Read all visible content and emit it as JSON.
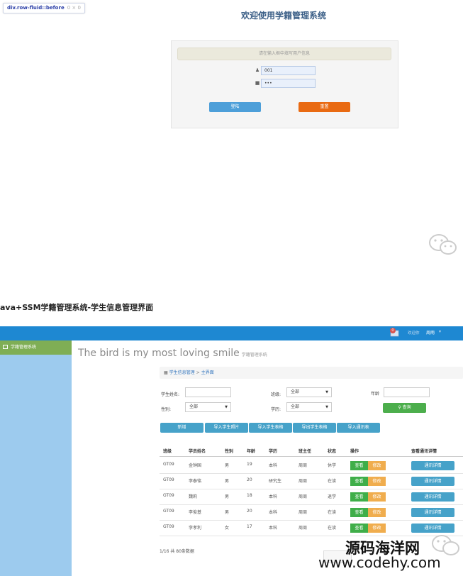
{
  "devtools_tag": {
    "selector": "div.row-fluid::before",
    "size": "0 × 0"
  },
  "login": {
    "title": "欢迎使用学籍管理系统",
    "hint": "请在输入框中填写用户信息",
    "username_value": "001",
    "password_value": "•••",
    "login_button": "登陆",
    "reset_button": "重置"
  },
  "caption": "ava+SSM学籍管理系统-学生信息管理界面",
  "topbar": {
    "notification_count": "0",
    "welcome_label": "欢迎你",
    "username": "周雨",
    "brand_color": "#1e88d2"
  },
  "sidebar": {
    "items": [
      {
        "label": "学籍管理系统"
      }
    ]
  },
  "main": {
    "headline": "The bird is my most loving smile",
    "headline_sub": "学籍管理系统",
    "breadcrumb": {
      "section": "学生信息管理",
      "page": "主界面"
    },
    "filters": {
      "name_label": "学生姓名:",
      "class_label": "班级:",
      "class_value": "全部",
      "age_label": "年龄",
      "gender_label": "性别:",
      "gender_value": "全部",
      "education_label": "学历:",
      "education_value": "全部",
      "query_button": "查询"
    },
    "toolbar": [
      "新增",
      "导入学生照片",
      "导入学生表格",
      "导出学生表格",
      "导入通讯表"
    ],
    "table": {
      "headers": [
        "班级",
        "学员姓名",
        "性别",
        "年龄",
        "学历",
        "班主任",
        "状态",
        "操作",
        "查看通讯详情"
      ],
      "rows": [
        {
          "class": "GT09",
          "name": "金钟国",
          "gender": "男",
          "age": "19",
          "education": "本科",
          "teacher": "周周",
          "status": "休学"
        },
        {
          "class": "GT09",
          "name": "李泰铭",
          "gender": "男",
          "age": "20",
          "education": "研究生",
          "teacher": "周周",
          "status": "在读"
        },
        {
          "class": "GT09",
          "name": "魏莉",
          "gender": "男",
          "age": "18",
          "education": "本科",
          "teacher": "周周",
          "status": "退学"
        },
        {
          "class": "GT09",
          "name": "李俊基",
          "gender": "男",
          "age": "20",
          "education": "本科",
          "teacher": "周周",
          "status": "在读"
        },
        {
          "class": "GT09",
          "name": "李孝利",
          "gender": "女",
          "age": "17",
          "education": "本科",
          "teacher": "周周",
          "status": "在读"
        }
      ],
      "view_label": "查看",
      "edit_label": "修改",
      "detail_label": "通讯详情"
    },
    "pager_info": "1/16 共 80条数据"
  },
  "watermark": {
    "name": "源码海洋网",
    "url": "www.codehy.com"
  }
}
